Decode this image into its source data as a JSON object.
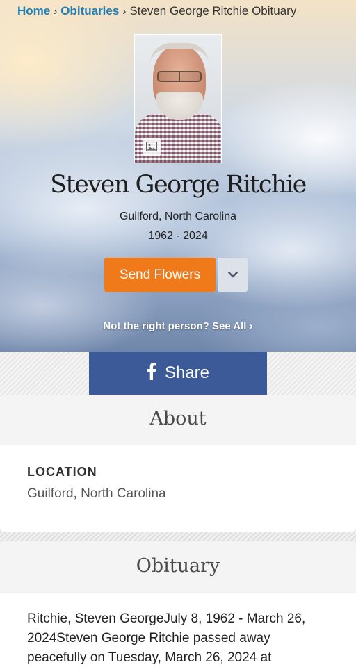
{
  "breadcrumb": {
    "home": "Home",
    "obituaries": "Obituaries",
    "separator": "›",
    "current": "Steven George Ritchie Obituary"
  },
  "profile": {
    "name": "Steven George Ritchie",
    "location": "Guilford, North Carolina",
    "dates": "1962 - 2024",
    "photo_icon": "image-icon"
  },
  "actions": {
    "send_flowers": "Send Flowers",
    "dropdown_icon": "chevron-down-icon",
    "not_right_person": "Not the right person? See All ›"
  },
  "share": {
    "icon": "facebook-icon",
    "label": "Share"
  },
  "about": {
    "title": "About",
    "location_label": "LOCATION",
    "location_value": "Guilford, North Carolina"
  },
  "obituary": {
    "title": "Obituary",
    "text": "Ritchie, Steven GeorgeJuly 8, 1962 - March 26, 2024Steven George Ritchie passed away peacefully on Tuesday, March 26, 2024 at"
  },
  "colors": {
    "link": "#1f7fb8",
    "flowers_button": "#f07a1a",
    "facebook": "#3d5a98"
  }
}
